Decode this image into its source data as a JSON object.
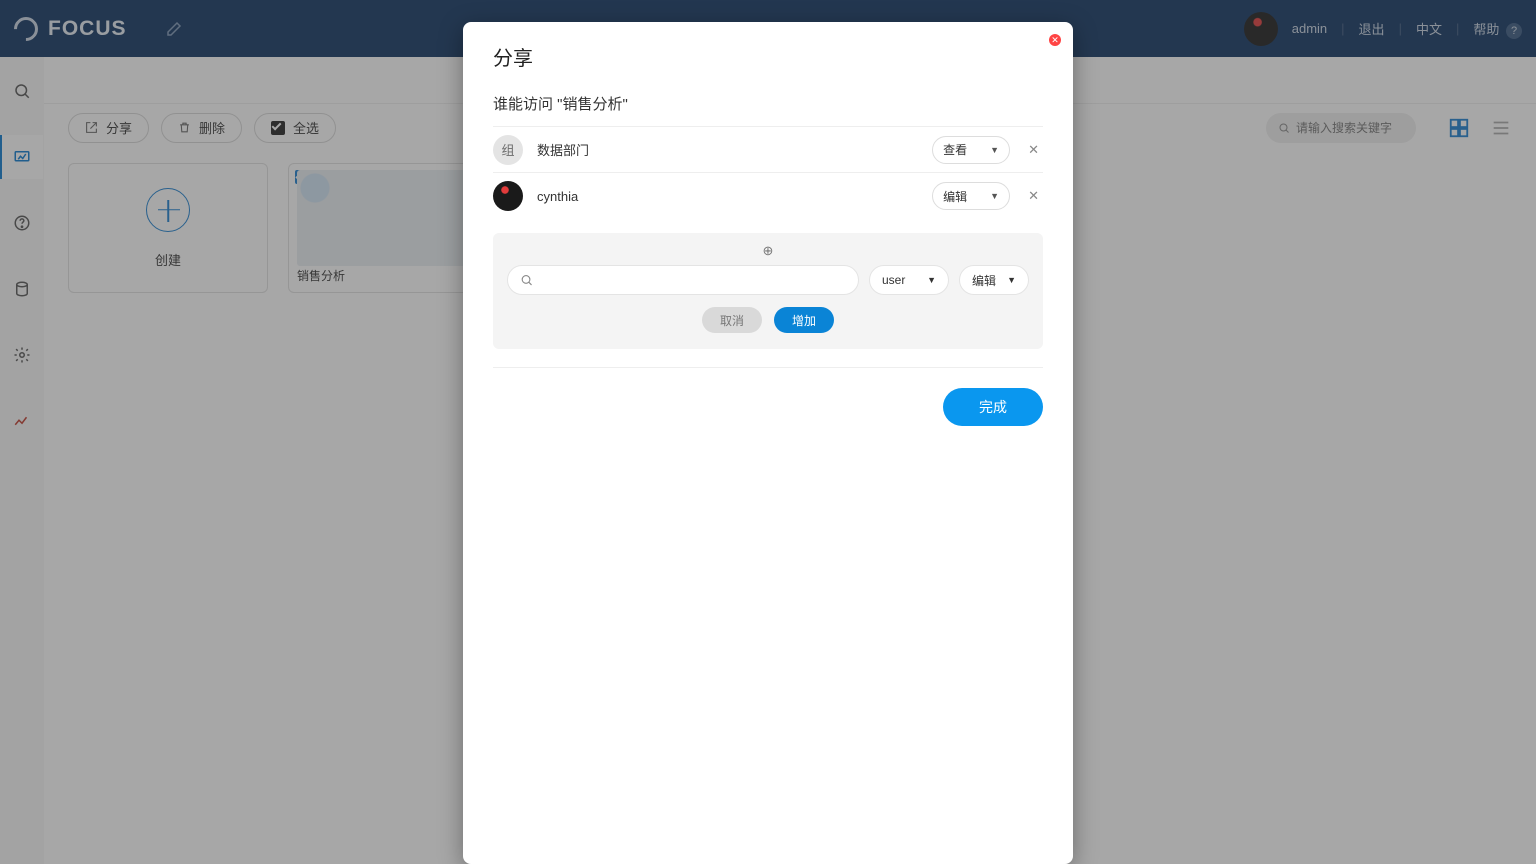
{
  "brand": "FOCUS",
  "topbar": {
    "username": "admin",
    "logout": "退出",
    "language": "中文",
    "help": "帮助",
    "help_badge": "?"
  },
  "toolbar": {
    "share": "分享",
    "delete": "删除",
    "select_all": "全选",
    "search_placeholder": "请输入搜索关键字"
  },
  "cards": {
    "create_label": "创建",
    "item1_title": "销售分析"
  },
  "modal": {
    "title": "分享",
    "subtitle": "谁能访问 \"销售分析\"",
    "rows": [
      {
        "badge": "组",
        "name": "数据部门",
        "perm": "查看"
      },
      {
        "badge": "user",
        "name": "cynthia",
        "perm": "编辑"
      }
    ],
    "add": {
      "type_select": "user",
      "perm_select": "编辑",
      "cancel": "取消",
      "add": "增加"
    },
    "done": "完成"
  }
}
